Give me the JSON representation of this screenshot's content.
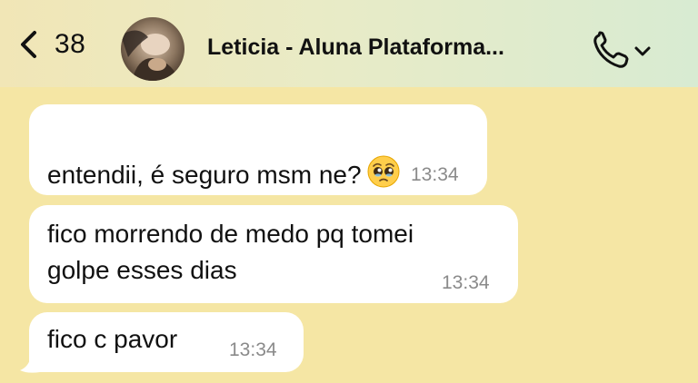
{
  "header": {
    "back_count": "38",
    "contact_name": "Leticia - Aluna Plataforma...",
    "back_icon": "chevron-left-icon",
    "call_icon": "phone-icon",
    "dropdown_icon": "chevron-down-icon"
  },
  "messages": [
    {
      "text": "entendii, é seguro msm ne?",
      "emoji": "pleading-face-emoji",
      "time": "13:34"
    },
    {
      "text": "fico morrendo de medo pq tomei\ngolpe esses dias",
      "time": "13:34"
    },
    {
      "text": "fico c pavor",
      "time": "13:34"
    }
  ],
  "colors": {
    "chat_background": "#f5e6a4",
    "bubble": "#ffffff",
    "timestamp": "#8a8a8a"
  }
}
